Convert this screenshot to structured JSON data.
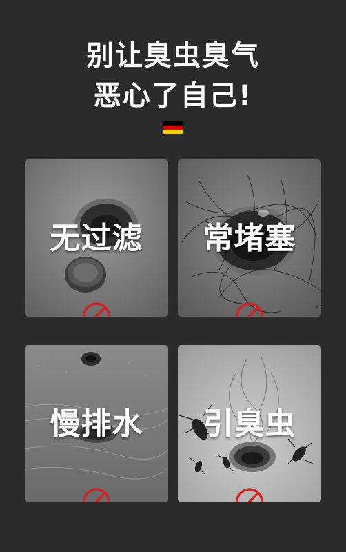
{
  "headline": {
    "line1": "别让臭虫臭气",
    "line2": "恶心了自己!"
  },
  "flag": {
    "colors": [
      "#000000",
      "#dd0000",
      "#ffce00"
    ]
  },
  "cards": [
    {
      "label": "无过滤",
      "icon": "prohibited-icon"
    },
    {
      "label": "常堵塞",
      "icon": "prohibited-icon"
    },
    {
      "label": "慢排水",
      "icon": "prohibited-icon"
    },
    {
      "label": "引臭虫",
      "icon": "prohibited-icon"
    }
  ],
  "colors": {
    "background": "#2b2b2b",
    "prohibited_red": "#d32222",
    "text": "#ffffff"
  }
}
